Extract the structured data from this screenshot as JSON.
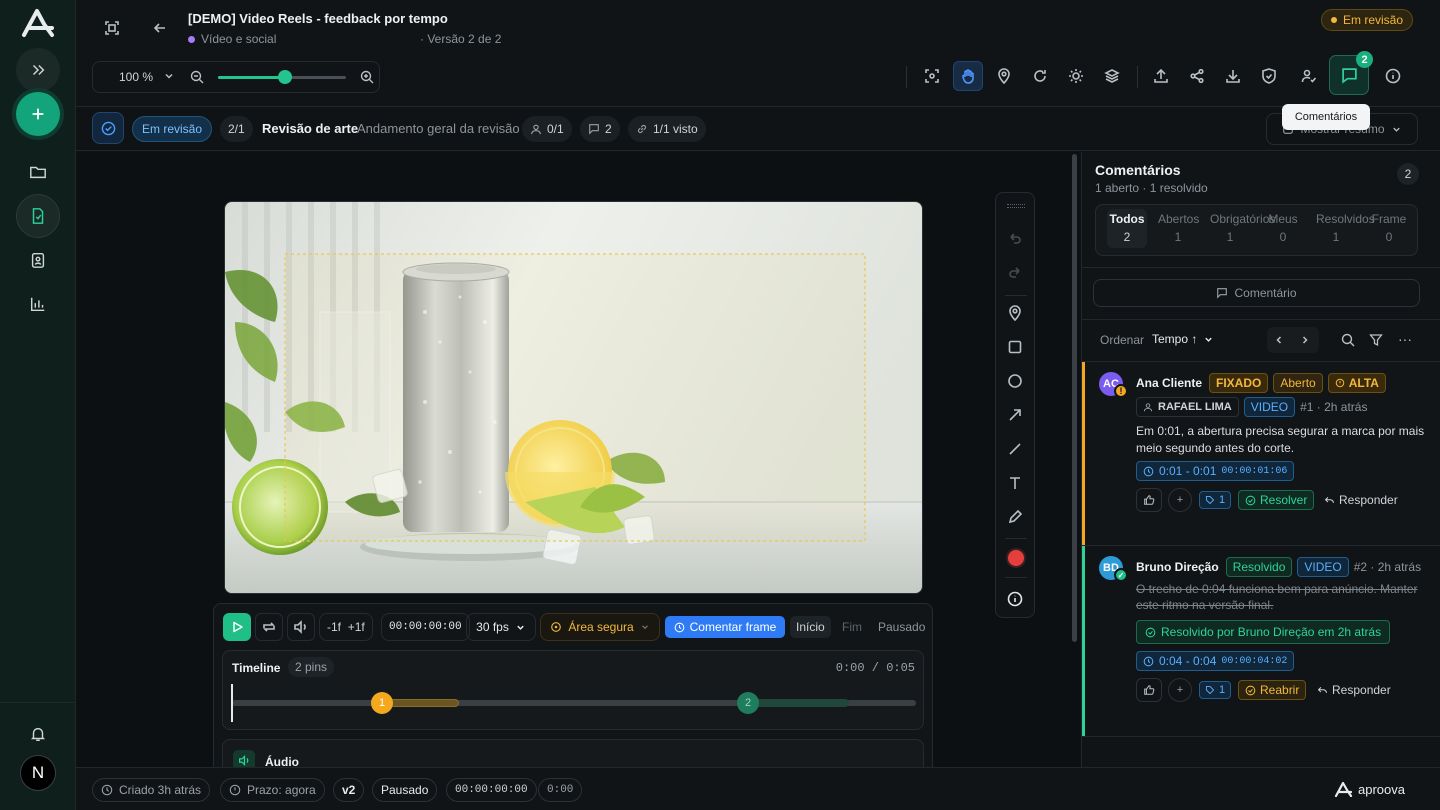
{
  "app": {
    "brand": "aproova"
  },
  "header": {
    "title": "[DEMO] Video Reels - feedback por tempo",
    "category": "Vídeo e social",
    "version": "Versão 2 de 2",
    "status": "Em revisão",
    "zoom": "100 %",
    "zoom_level": 0.52,
    "comments_badge": "2",
    "tooltip": "Comentários",
    "icons": [
      "fit-screen-icon",
      "back-arrow-icon",
      "zoom-out-icon",
      "zoom-in-icon",
      "focus-icon",
      "hand-icon",
      "pin-icon",
      "refresh-icon",
      "sun-icon",
      "layers-icon",
      "upload-icon",
      "share-icon",
      "download-icon",
      "shield-icon",
      "user-check-icon",
      "chat-icon",
      "info-icon"
    ]
  },
  "subbar": {
    "status": "Em revisão",
    "step": "2/1",
    "stage_title": "Revisão de arte",
    "stage_desc": "Andamento geral da revisão",
    "reviewers": "0/1",
    "comments": "2",
    "seen": "1/1 visto",
    "summary": "Mostrar resumo"
  },
  "player": {
    "controls": {
      "minus_frame": "-1f",
      "plus_frame": "+1f",
      "timecode": "00:00:00:00",
      "fps": "30 fps",
      "safe_area": "Área segura",
      "comment_frame": "Comentar frame",
      "start": "Início",
      "end": "Fim",
      "state": "Pausado"
    },
    "timeline": {
      "label": "Timeline",
      "pins": "2 pins",
      "time": "0:00 / 0:05",
      "pin1": "1",
      "pin2": "2"
    },
    "audio": "Áudio"
  },
  "comments": {
    "title": "Comentários",
    "subtitle": "1 aberto · 1 resolvido",
    "count": "2",
    "tabs": [
      {
        "label": "Todos",
        "count": "2"
      },
      {
        "label": "Abertos",
        "count": "1"
      },
      {
        "label": "Obrigatórios",
        "count": "1"
      },
      {
        "label": "Meus",
        "count": "0"
      },
      {
        "label": "Resolvidos",
        "count": "1"
      },
      {
        "label": "Frame",
        "count": "0"
      }
    ],
    "new_button": "Comentário",
    "sort_label": "Ordenar",
    "sort_value": "Tempo ↑",
    "items": [
      {
        "initials": "AC",
        "author": "Ana Cliente",
        "badge": "!",
        "tags": [
          "FIXADO",
          "Aberto",
          "ALTA"
        ],
        "assignee": "RAFAEL LIMA",
        "media": "VIDEO",
        "meta": "#1 · 2h atrás",
        "text": "Em 0:01, a abertura precisa segurar a marca por mais meio segundo antes do corte.",
        "range": "0:01 - 0:01",
        "range_tc": "00:00:01:06",
        "reaction_add": "+",
        "tag_count": "1",
        "action": "Resolver",
        "reply": "Responder"
      },
      {
        "initials": "BD",
        "author": "Bruno Direção",
        "badge": "✓",
        "tags": [
          "Resolvido"
        ],
        "media": "VIDEO",
        "meta": "#2 · 2h atrás",
        "text": "O trecho de 0:04 funciona bem para anúncio. Manter este ritmo na versão final.",
        "resolved_by": "Resolvido por Bruno Direção em 2h atrás",
        "range": "0:04 - 0:04",
        "range_tc": "00:00:04:02",
        "reaction_add": "+",
        "tag_count": "1",
        "action": "Reabrir",
        "reply": "Responder"
      }
    ]
  },
  "footer": {
    "created": "Criado 3h atrás",
    "deadline": "Prazo: agora",
    "version": "v2",
    "state": "Pausado",
    "timecode": "00:00:00:00",
    "time": "0:00"
  },
  "colors": {
    "accent": "#22c38e",
    "status": "#f5b73b",
    "blue": "#2f7bf6",
    "bg": "#0f1215"
  }
}
